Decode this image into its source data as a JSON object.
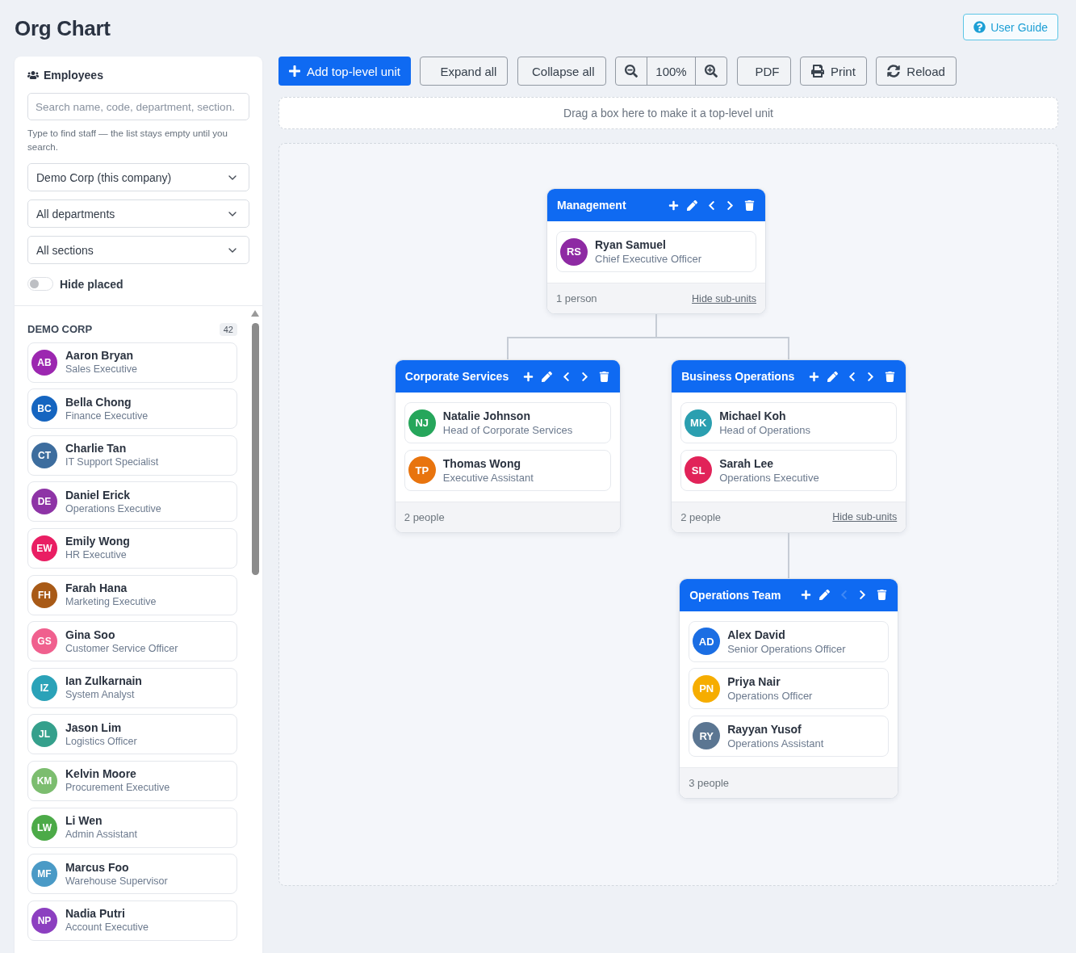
{
  "page": {
    "title": "Org Chart",
    "help_button": "User Guide"
  },
  "sidebar": {
    "title": "Employees",
    "search": {
      "placeholder": "Search name, code, department, section."
    },
    "hint": "Type to find staff — the list stays empty until you search.",
    "filters": [
      {
        "value": "Demo Corp (this company)"
      },
      {
        "value": "All departments"
      },
      {
        "value": "All sections"
      }
    ],
    "hide_placed": {
      "label": "Hide placed",
      "on": false
    },
    "group": {
      "name": "DEMO CORP",
      "count": "42"
    },
    "employees": [
      {
        "initials": "AB",
        "name": "Aaron Bryan",
        "role": "Sales Executive",
        "color": "#9c27b0"
      },
      {
        "initials": "BC",
        "name": "Bella Chong",
        "role": "Finance Executive",
        "color": "#1565c0"
      },
      {
        "initials": "CT",
        "name": "Charlie Tan",
        "role": "IT Support Specialist",
        "color": "#3d6d9e"
      },
      {
        "initials": "DE",
        "name": "Daniel Erick",
        "role": "Operations Executive",
        "color": "#8e34a6"
      },
      {
        "initials": "EW",
        "name": "Emily Wong",
        "role": "HR Executive",
        "color": "#e91e63"
      },
      {
        "initials": "FH",
        "name": "Farah Hana",
        "role": "Marketing Executive",
        "color": "#a85a17"
      },
      {
        "initials": "GS",
        "name": "Gina Soo",
        "role": "Customer Service Officer",
        "color": "#f0608e"
      },
      {
        "initials": "IZ",
        "name": "Ian Zulkarnain",
        "role": "System Analyst",
        "color": "#2aa2b8"
      },
      {
        "initials": "JL",
        "name": "Jason Lim",
        "role": "Logistics Officer",
        "color": "#35a08c"
      },
      {
        "initials": "KM",
        "name": "Kelvin Moore",
        "role": "Procurement Executive",
        "color": "#7cbd6f"
      },
      {
        "initials": "LW",
        "name": "Li Wen",
        "role": "Admin Assistant",
        "color": "#4caa48"
      },
      {
        "initials": "MF",
        "name": "Marcus Foo",
        "role": "Warehouse Supervisor",
        "color": "#4a9ac6"
      },
      {
        "initials": "NP",
        "name": "Nadia Putri",
        "role": "Account Executive",
        "color": "#8c3fc0"
      }
    ]
  },
  "toolbar": {
    "add_button": "Add top-level unit",
    "expand_button": "Expand all",
    "collapse_button": "Collapse all",
    "zoom_level": "100%",
    "pdf_button": "PDF",
    "print_button": "Print",
    "reload_button": "Reload"
  },
  "drop_zone": {
    "text": "Drag a box here to make it a top-level unit"
  },
  "org_chart": {
    "units": [
      {
        "name": "Management",
        "move_left_disabled": false,
        "members": [
          {
            "initials": "RS",
            "name": "Ryan Samuel",
            "role": "Chief Executive Officer",
            "color": "#8e2aa3"
          }
        ],
        "count": "1 person",
        "hide_link": "Hide sub-units",
        "children": [
          {
            "name": "Corporate Services",
            "move_left_disabled": false,
            "members": [
              {
                "initials": "NJ",
                "name": "Natalie Johnson",
                "role": "Head of Corporate Services",
                "color": "#26a65b"
              },
              {
                "initials": "TP",
                "name": "Thomas Wong",
                "role": "Executive Assistant",
                "color": "#e8740e"
              }
            ],
            "count": "2 people"
          },
          {
            "name": "Business Operations",
            "move_left_disabled": false,
            "members": [
              {
                "initials": "MK",
                "name": "Michael Koh",
                "role": "Head of Operations",
                "color": "#2b9fb0"
              },
              {
                "initials": "SL",
                "name": "Sarah Lee",
                "role": "Operations Executive",
                "color": "#e12359"
              }
            ],
            "count": "2 people",
            "hide_link": "Hide sub-units",
            "children": [
              {
                "name": "Operations Team",
                "move_left_disabled": true,
                "members": [
                  {
                    "initials": "AD",
                    "name": "Alex David",
                    "role": "Senior Operations Officer",
                    "color": "#1b6ee3"
                  },
                  {
                    "initials": "PN",
                    "name": "Priya Nair",
                    "role": "Operations Officer",
                    "color": "#f6ad00"
                  },
                  {
                    "initials": "RY",
                    "name": "Rayyan Yusof",
                    "role": "Operations Assistant",
                    "color": "#5b7692"
                  }
                ],
                "count": "3 people"
              }
            ]
          }
        ]
      }
    ]
  }
}
